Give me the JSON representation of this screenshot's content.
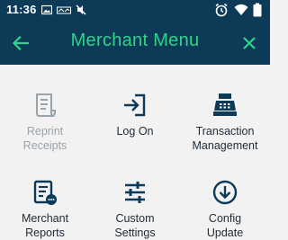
{
  "status_bar": {
    "time": "11:36",
    "icons": [
      "image-icon",
      "cast-icon",
      "no-sound-icon",
      "alarm-icon",
      "wifi-icon",
      "battery-icon"
    ]
  },
  "app_bar": {
    "title": "Merchant Menu",
    "back_icon": "arrow-left-icon",
    "close_icon": "close-icon"
  },
  "colors": {
    "app_bar_bg": "#0c3a57",
    "title": "#2fd48a",
    "icon": "#0c3a57",
    "disabled": "#9aa3ab",
    "background": "#f2f2f2"
  },
  "menu": [
    {
      "label": "Reprint\nReceipts",
      "icon": "receipt-icon",
      "enabled": false
    },
    {
      "label": "Log On",
      "icon": "login-icon",
      "enabled": true
    },
    {
      "label": "Transaction\nManagement",
      "icon": "cash-register-icon",
      "enabled": true
    },
    {
      "label": "Merchant\nReports",
      "icon": "report-icon",
      "enabled": true
    },
    {
      "label": "Custom\nSettings",
      "icon": "sliders-icon",
      "enabled": true
    },
    {
      "label": "Config\nUpdate",
      "icon": "download-circle-icon",
      "enabled": true
    }
  ]
}
